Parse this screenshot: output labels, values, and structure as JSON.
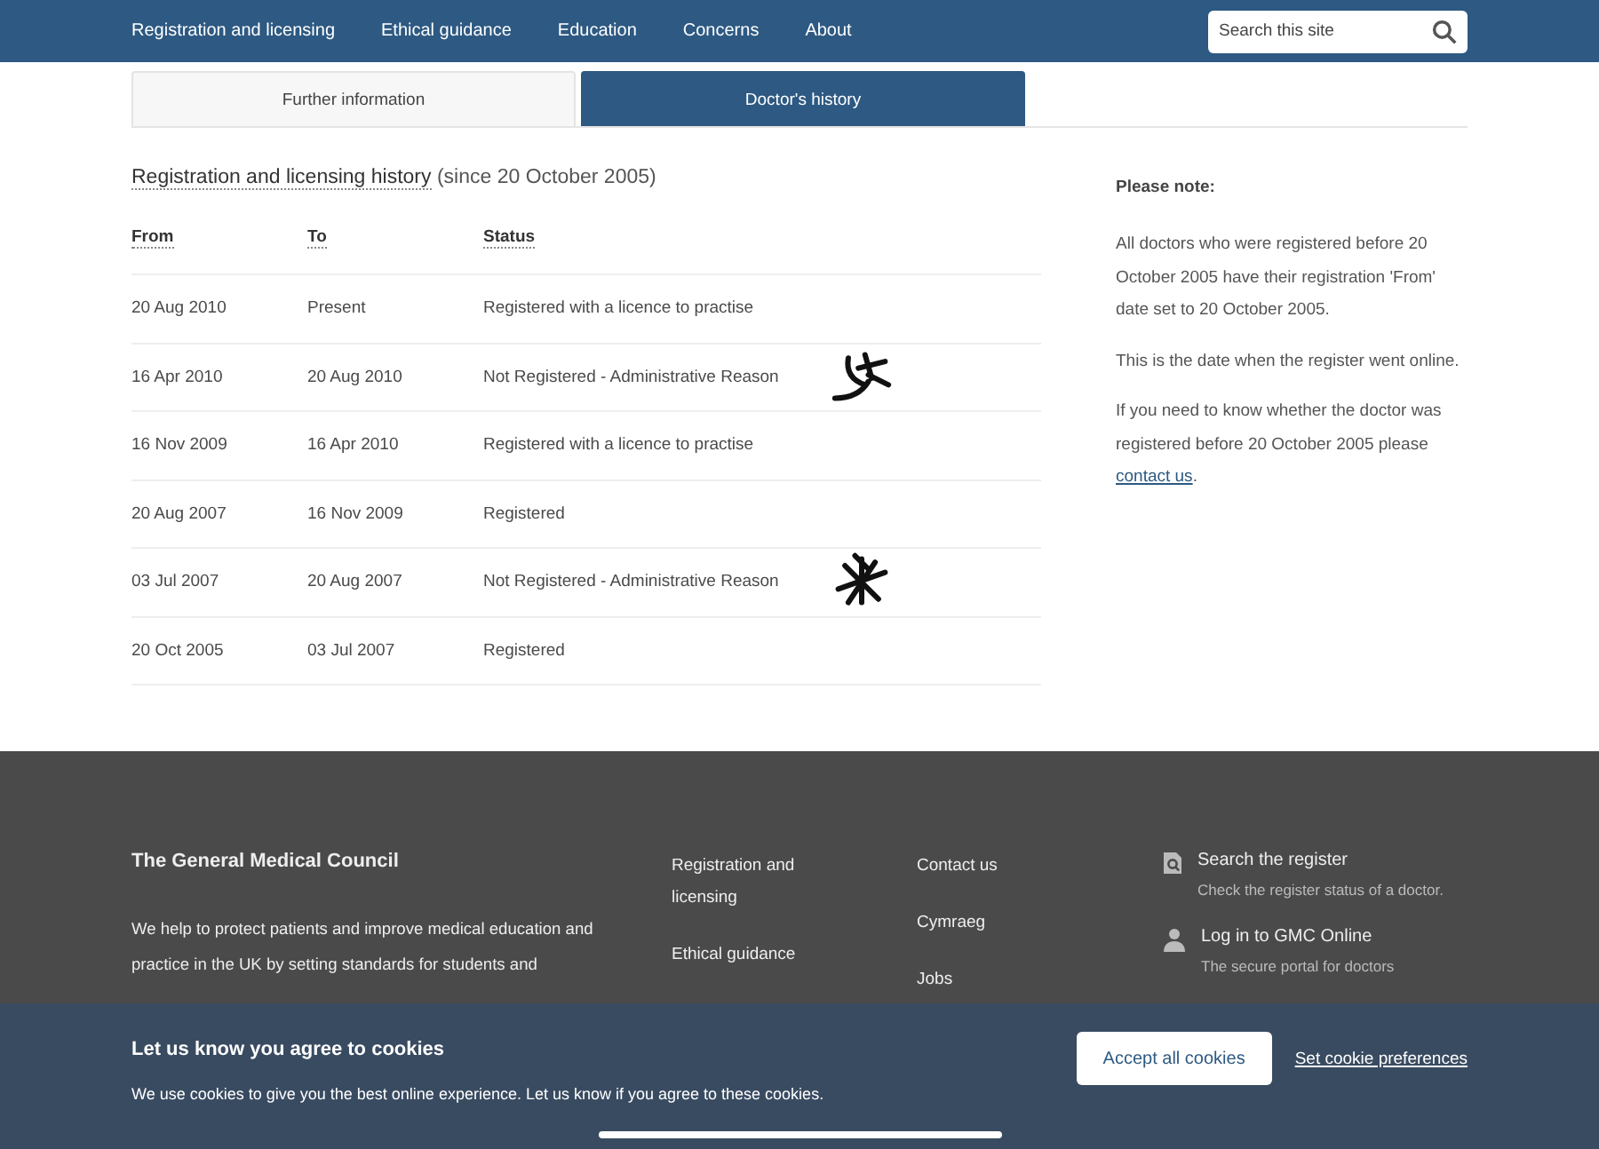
{
  "nav": {
    "items": [
      {
        "label": "Registration and licensing"
      },
      {
        "label": "Ethical guidance"
      },
      {
        "label": "Education"
      },
      {
        "label": "Concerns"
      },
      {
        "label": "About"
      }
    ],
    "search": {
      "placeholder": "Search this site"
    }
  },
  "tabs": [
    {
      "label": "Further information",
      "selected": false
    },
    {
      "label": "Doctor's history",
      "selected": true
    }
  ],
  "history": {
    "title": "Registration and licensing history",
    "subtitle": "(since 20 October 2005)",
    "columns": [
      "From",
      "To",
      "Status"
    ],
    "rows": [
      {
        "cells": [
          "20 Aug 2010",
          "Present",
          "Registered with a licence to practise"
        ],
        "annotated": false
      },
      {
        "cells": [
          "16 Apr 2010",
          "20 Aug 2010",
          "Not Registered - Administrative Reason"
        ],
        "annotated": true
      },
      {
        "cells": [
          "16 Nov 2009",
          "16 Apr 2010",
          "Registered with a licence to practise"
        ],
        "annotated": false
      },
      {
        "cells": [
          "20 Aug 2007",
          "16 Nov 2009",
          "Registered"
        ],
        "annotated": false
      },
      {
        "cells": [
          "03 Jul 2007",
          "20 Aug 2007",
          "Not Registered - Administrative Reason"
        ],
        "annotated": true
      },
      {
        "cells": [
          "20 Oct 2005",
          "03 Jul 2007",
          "Registered"
        ],
        "annotated": false
      }
    ]
  },
  "note": {
    "heading": "Please note:",
    "paragraphs": [
      "All doctors who were registered before 20 October 2005 have their registration 'From' date set to 20 October 2005.",
      "This is the date when the register went online."
    ],
    "last_text": "If you need to know whether the doctor was registered before 20 October 2005 please",
    "link": "contact us",
    "end": "."
  },
  "footer": {
    "title": "The General Medical Council",
    "about": "We help to protect patients and improve medical education and practice in the UK by setting standards for students and",
    "links_1": [
      "Registration and licensing",
      "Ethical guidance"
    ],
    "links_2": [
      "Contact us",
      "Cymraeg",
      "Jobs"
    ],
    "services": [
      {
        "kind": "search",
        "title": "Search the register",
        "text": "Check the register status of a doctor."
      },
      {
        "kind": "login",
        "title": "Log in to GMC Online",
        "text": "The secure portal for doctors"
      }
    ]
  },
  "cookies": {
    "title": "Let us know you agree to cookies",
    "text": "We use cookies to give you the best online experience. Let us know if you agree to these cookies.",
    "accept": "Accept all cookies",
    "preferences": "Set cookie preferences"
  }
}
